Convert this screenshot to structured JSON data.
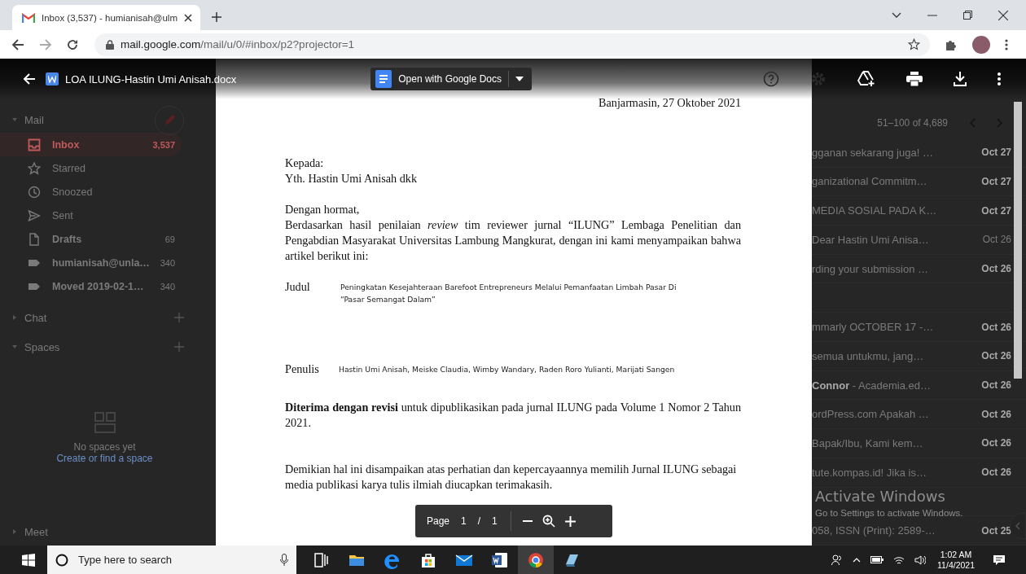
{
  "browser": {
    "tabs": [
      {
        "title": "Inbox (3,537) - humianisah@ulm",
        "selected": true
      }
    ],
    "address": {
      "host": "mail.google.com",
      "path": "/mail/u/0/#inbox/p2?projector=1"
    }
  },
  "viewer": {
    "file_name": "LOA ILUNG-Hastin Umi Anisah.docx",
    "open_button": "Open with Google Docs",
    "page_control": {
      "label": "Page",
      "current": "1",
      "separator": "/",
      "total": "1"
    }
  },
  "document": {
    "date": "Banjarmasin, 27 Oktober  2021",
    "recipient_label": "Kepada:",
    "recipient": "Yth. Hastin Umi Anisah dkk",
    "greeting": "Dengan hormat,",
    "intro": "Berdasarkan hasil penilaian *review* tim reviewer jurnal “ILUNG” Lembaga Penelitian dan Pengabdian Masyarakat Universitas Lambung Mangkurat, dengan ini kami menyampaikan bahwa artikel berikut ini:",
    "fields": [
      {
        "label": "Judul",
        "value": "Peningkatan Kesejahteraan Barefoot Entrepreneurs Melalui Pemanfaatan Limbah Pasar Di “Pasar Semangat Dalam”"
      },
      {
        "label": "Penulis",
        "value": "Hastin Umi Anisah, Meiske Claudia, Wimby Wandary, Raden Roro Yulianti, Marijati Sangen"
      }
    ],
    "decision": "**Diterima dengan revisi** untuk dipublikasikan pada jurnal ILUNG  pada Volume 1 Nomor 2 Tahun 2021.",
    "closing": "Demikian hal ini disampaikan atas perhatian dan kepercayaannya memilih Jurnal ILUNG sebagai media publikasi karya tulis ilmiah diucapkan terimakasih."
  },
  "mail_sidebar": {
    "sections": [
      {
        "label": "Mail",
        "expanded": true,
        "addable": false,
        "items": [
          {
            "kind": "inbox",
            "label": "Inbox",
            "count": "3,537",
            "selected": true,
            "unread": true
          },
          {
            "kind": "star",
            "label": "Starred",
            "selected": false,
            "unread": false
          },
          {
            "kind": "clock",
            "label": "Snoozed",
            "selected": false,
            "unread": false
          },
          {
            "kind": "send",
            "label": "Sent",
            "selected": false,
            "unread": false
          },
          {
            "kind": "draft",
            "label": "Drafts",
            "count": "69",
            "selected": false,
            "unread": true
          },
          {
            "kind": "label",
            "label": "humianisah@unla…",
            "count": "340",
            "selected": false,
            "unread": true
          },
          {
            "kind": "label",
            "label": "Moved 2019-02-1…",
            "count": "340",
            "selected": false,
            "unread": true
          }
        ]
      },
      {
        "label": "Chat",
        "expanded": false,
        "addable": true
      },
      {
        "label": "Spaces",
        "expanded": true,
        "addable": true,
        "empty_text": "No spaces yet",
        "link": "Create or find a space"
      },
      {
        "label": "Meet",
        "expanded": false,
        "addable": false
      }
    ]
  },
  "mail_list": {
    "pager": "51–100 of 4,689",
    "rows": [
      {
        "kind": "email",
        "snippet": "gganan sekarang juga! …",
        "date": "Oct 27",
        "unread": true
      },
      {
        "kind": "email",
        "snippet": "ganizational Commitm…",
        "date": "Oct 27",
        "unread": true
      },
      {
        "kind": "email",
        "snippet": "MEDIA SOSIAL PADA K…",
        "date": "Oct 27",
        "unread": true
      },
      {
        "kind": "email",
        "snippet": "Dear Hastin Umi Anisa…",
        "date": "Oct 26",
        "unread": false
      },
      {
        "kind": "email",
        "snippet": "rding your submission …",
        "date": "Oct 26",
        "unread": true
      },
      {
        "kind": "blank"
      },
      {
        "kind": "email",
        "snippet": "mmarly OCTOBER 17 -…",
        "date": "Oct 26",
        "unread": true
      },
      {
        "kind": "email",
        "snippet": "semua untukmu, jang…",
        "date": "Oct 26",
        "unread": true
      },
      {
        "kind": "email",
        "snippet": "**Connor** - Academia.ed…",
        "date": "Oct 26",
        "unread": true
      },
      {
        "kind": "email",
        "snippet": "ordPress.com Apakah …",
        "date": "Oct 26",
        "unread": true
      },
      {
        "kind": "email",
        "snippet": "Bapak/Ibu, Kami kem…",
        "date": "Oct 26",
        "unread": true
      },
      {
        "kind": "email",
        "snippet": "tute.kompas.id! Jika is…",
        "date": "Oct 26",
        "unread": true
      },
      {
        "kind": "blank"
      },
      {
        "kind": "email",
        "snippet": "058, ISSN (Print): 2589-…",
        "date": "Oct 25",
        "unread": true
      }
    ]
  },
  "activation_notice": {
    "title": "Activate Windows",
    "hint": "Go to Settings to activate Windows."
  },
  "taskbar": {
    "search": {
      "placeholder": "Type here to search"
    },
    "apps": [
      {
        "kind": "taskview",
        "selected": false
      },
      {
        "kind": "folder",
        "selected": false
      },
      {
        "kind": "edge",
        "selected": false
      },
      {
        "kind": "store",
        "selected": false
      },
      {
        "kind": "mail",
        "selected": false
      },
      {
        "kind": "word",
        "selected": false
      },
      {
        "kind": "chrome",
        "selected": true
      },
      {
        "kind": "app",
        "selected": false
      }
    ],
    "clock": {
      "time": "1:02 AM",
      "date": "11/4/2021"
    }
  }
}
